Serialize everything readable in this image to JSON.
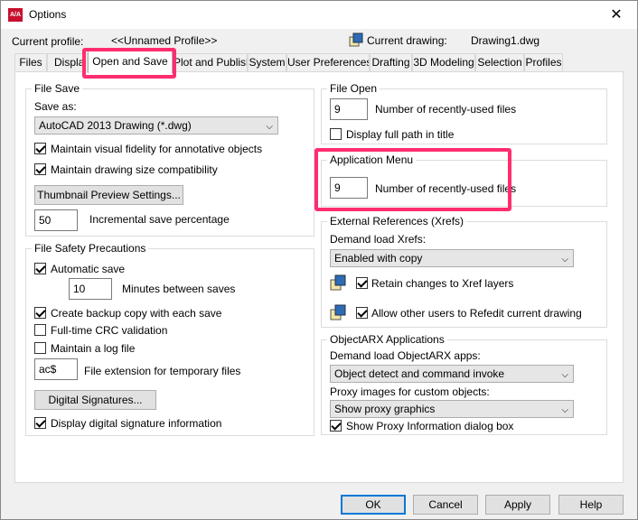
{
  "window": {
    "title": "Options",
    "app_icon": "A/A"
  },
  "profile": {
    "current_profile_label": "Current profile:",
    "current_profile_value": "<<Unnamed Profile>>",
    "current_drawing_label": "Current drawing:",
    "current_drawing_value": "Drawing1.dwg"
  },
  "tabs": [
    {
      "label": "Files"
    },
    {
      "label": "Displa"
    },
    {
      "label": "Open and Save"
    },
    {
      "label": "Plot and Publish"
    },
    {
      "label": "System"
    },
    {
      "label": "User Preferences"
    },
    {
      "label": "Drafting"
    },
    {
      "label": "3D Modeling"
    },
    {
      "label": "Selection"
    },
    {
      "label": "Profiles"
    }
  ],
  "file_save": {
    "title": "File Save",
    "save_as_label": "Save as:",
    "save_as_value": "AutoCAD 2013 Drawing (*.dwg)",
    "maintain_fidelity": {
      "label": "Maintain visual fidelity for annotative objects",
      "checked": true
    },
    "maintain_size": {
      "label": "Maintain drawing size compatibility",
      "checked": true
    },
    "thumbnail_button": "Thumbnail Preview Settings...",
    "incremental_value": "50",
    "incremental_label": "Incremental save percentage"
  },
  "file_safety": {
    "title": "File Safety Precautions",
    "automatic_save": {
      "label": "Automatic save",
      "checked": true
    },
    "minutes_value": "10",
    "minutes_label": "Minutes between saves",
    "backup_copy": {
      "label": "Create backup copy with each save",
      "checked": true
    },
    "crc_validation": {
      "label": "Full-time CRC validation",
      "checked": false
    },
    "maintain_log": {
      "label": "Maintain a log file",
      "checked": false
    },
    "extension_value": "ac$",
    "extension_label": "File extension for temporary files",
    "digital_signatures_button": "Digital Signatures...",
    "display_signature": {
      "label": "Display digital signature information",
      "checked": true
    }
  },
  "file_open": {
    "title": "File Open",
    "recent_files_value": "9",
    "recent_files_label": "Number of recently-used files",
    "full_path": {
      "label": "Display full path in title",
      "checked": false
    }
  },
  "application_menu": {
    "title": "Application Menu",
    "recent_files_value": "9",
    "recent_files_label": "Number of recently-used files"
  },
  "xrefs": {
    "title": "External References (Xrefs)",
    "demand_load_label": "Demand load Xrefs:",
    "demand_load_value": "Enabled with copy",
    "retain_changes": {
      "label": "Retain changes to Xref layers",
      "checked": true
    },
    "allow_refedit": {
      "label": "Allow other users to Refedit current drawing",
      "checked": true
    }
  },
  "objectarx": {
    "title": "ObjectARX Applications",
    "demand_load_label": "Demand load ObjectARX apps:",
    "demand_load_value": "Object detect and command invoke",
    "proxy_label": "Proxy images for custom objects:",
    "proxy_value": "Show proxy graphics",
    "show_proxy_dialog": {
      "label": "Show Proxy Information dialog box",
      "checked": true
    }
  },
  "footer": {
    "ok": "OK",
    "cancel": "Cancel",
    "apply": "Apply",
    "help": "Help"
  },
  "colors": {
    "highlight": "#ff2d6f",
    "accent": "#0078d7",
    "app_icon": "#c8102e"
  }
}
